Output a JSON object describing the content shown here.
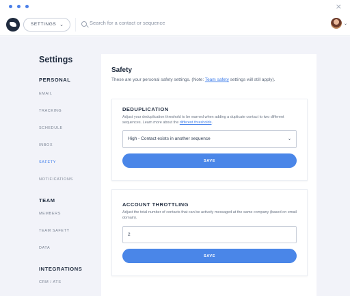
{
  "window": {
    "dot_color": "#4a7fe8",
    "close_icon": "×"
  },
  "appbar": {
    "settings_dropdown_label": "SETTINGS",
    "chevron": "⌄",
    "search_placeholder": "Search for a contact or sequence"
  },
  "sidebar": {
    "title": "Settings",
    "sections": {
      "personal": "PERSONAL",
      "team": "TEAM",
      "integrations": "INTEGRATIONS"
    },
    "items": {
      "email": "EMAIL",
      "tracking": "TRACKING",
      "schedule": "SCHEDULE",
      "inbox": "INBOX",
      "safety": "SAFETY",
      "notifications": "NOTIFICATIONS",
      "members": "MEMBERS",
      "team_safety": "TEAM SAFETY",
      "data": "DATA",
      "crm_ats": "CRM / ATS"
    }
  },
  "panel": {
    "title": "Safety",
    "desc_prefix": "These are your personal safety settings. (Note: ",
    "desc_link": "Team safety",
    "desc_suffix": " settings will still apply)."
  },
  "deduplication": {
    "title": "DEDUPLICATION",
    "desc_text": "Adjust your deduplication threshold to be warned when adding a duplicate contact to two different sequences. Learn more about the ",
    "desc_link": "different thresholds",
    "desc_end": ".",
    "selected": "High - Contact exists in another sequence",
    "save_label": "SAVE"
  },
  "throttling": {
    "title": "ACCOUNT THROTTLING",
    "desc": "Adjust the total number of contacts that can be actively messaged at the same company (based on email domain).",
    "value": "2",
    "save_label": "SAVE"
  },
  "colors": {
    "accent": "#4a86e8",
    "active_nav": "#3b7bea",
    "background": "#f2f3f9"
  }
}
